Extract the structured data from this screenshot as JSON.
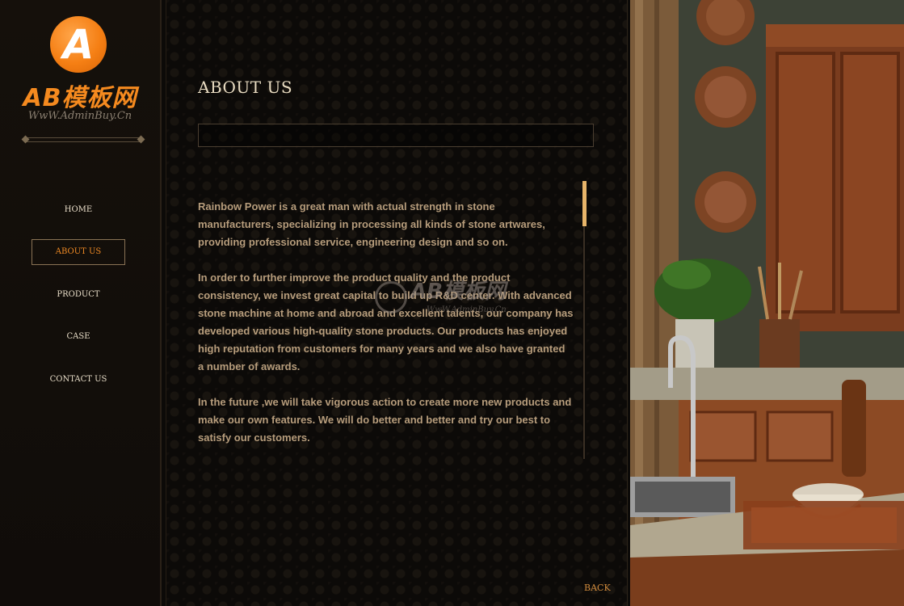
{
  "brand": {
    "logo_letter": "A",
    "logo_text": "AB模板网",
    "logo_url": "WwW.AdminBuy.Cn"
  },
  "nav": {
    "items": [
      {
        "label": "HOME",
        "active": false
      },
      {
        "label": "ABOUT US",
        "active": true
      },
      {
        "label": "PRODUCT",
        "active": false
      },
      {
        "label": "CASE",
        "active": false
      },
      {
        "label": "CONTACT US",
        "active": false
      }
    ]
  },
  "main": {
    "title": "ABOUT US",
    "paragraphs": [
      "Rainbow Power is a great man with actual strength in stone manufacturers, specializing in processing all kinds of stone artwares, providing professional service, engineering design and so on.",
      "In order to further improve the product quality and the product consistency, we invest great capital to build up R&D center. With advanced stone machine at home and abroad and excellent talents, our company has developed various high-quality stone products. Our products has enjoyed high reputation from customers for many years and we also have granted a number of awards.",
      "In the future ,we will take vigorous action to create more new products and make our own features. We will do better and better and try our best to satisfy our customers."
    ],
    "back_label": "BACK"
  },
  "watermark": {
    "text": "AB模板网",
    "url": "WwW.AdminBuy.Cn"
  },
  "colors": {
    "accent": "#f08a24",
    "text": "#b79d7c",
    "scroll_thumb": "#e8b56a"
  }
}
